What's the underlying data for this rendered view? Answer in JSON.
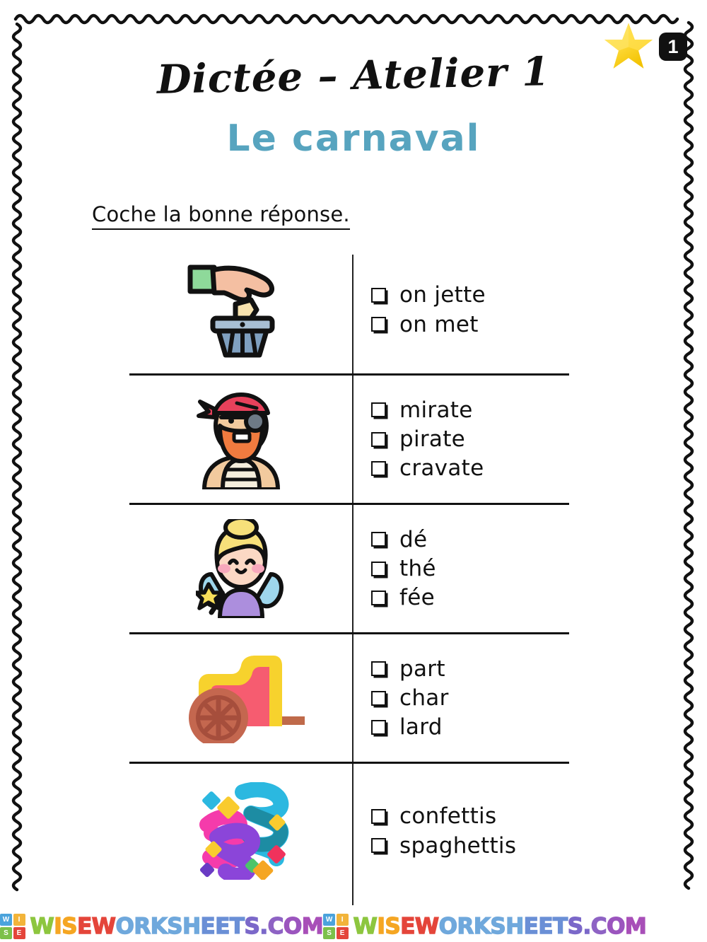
{
  "worksheet": {
    "title": "Dictée – Atelier 1",
    "subtitle": "Le carnaval",
    "instruction": "Coche la bonne réponse.",
    "badge_number": "1",
    "star_icon": "gold-star-icon",
    "accent_color": "#57A4BF",
    "text_color": "#111111"
  },
  "exercises": [
    {
      "picture": "hand-throwing-paper-in-bin-icon",
      "options": [
        {
          "label": "on jette",
          "checked": false
        },
        {
          "label": "on met",
          "checked": false
        }
      ]
    },
    {
      "picture": "pirate-icon",
      "options": [
        {
          "label": "mirate",
          "checked": false
        },
        {
          "label": "pirate",
          "checked": false
        },
        {
          "label": "cravate",
          "checked": false
        }
      ]
    },
    {
      "picture": "fairy-icon",
      "options": [
        {
          "label": "dé",
          "checked": false
        },
        {
          "label": "thé",
          "checked": false
        },
        {
          "label": "fée",
          "checked": false
        }
      ]
    },
    {
      "picture": "chariot-icon",
      "options": [
        {
          "label": "part",
          "checked": false
        },
        {
          "label": "char",
          "checked": false
        },
        {
          "label": "lard",
          "checked": false
        }
      ]
    },
    {
      "picture": "confetti-streamers-icon",
      "options": [
        {
          "label": "confettis",
          "checked": false
        },
        {
          "label": "spaghettis",
          "checked": false
        }
      ]
    }
  ],
  "footer": {
    "watermark_text": "WISEWORKSHEETS.COM",
    "logo_letters": [
      "W",
      "I",
      "S",
      "E"
    ],
    "logo_colors": [
      "#4BA3DC",
      "#F2B43A",
      "#7CC04A",
      "#E4453A"
    ],
    "letter_colors": [
      "#8DC63F",
      "#F5A623",
      "#F5A623",
      "#E4453A",
      "#E4453A",
      "#6FA8DC",
      "#6FA8DC",
      "#6FA8DC",
      "#6FA8DC",
      "#6FA8DC",
      "#6A8FD6",
      "#6A8FD6",
      "#6A8FD6",
      "#7B68C9",
      "#7B68C9",
      "#8E63C4",
      "#9B55BE",
      "#A84FB8"
    ]
  }
}
